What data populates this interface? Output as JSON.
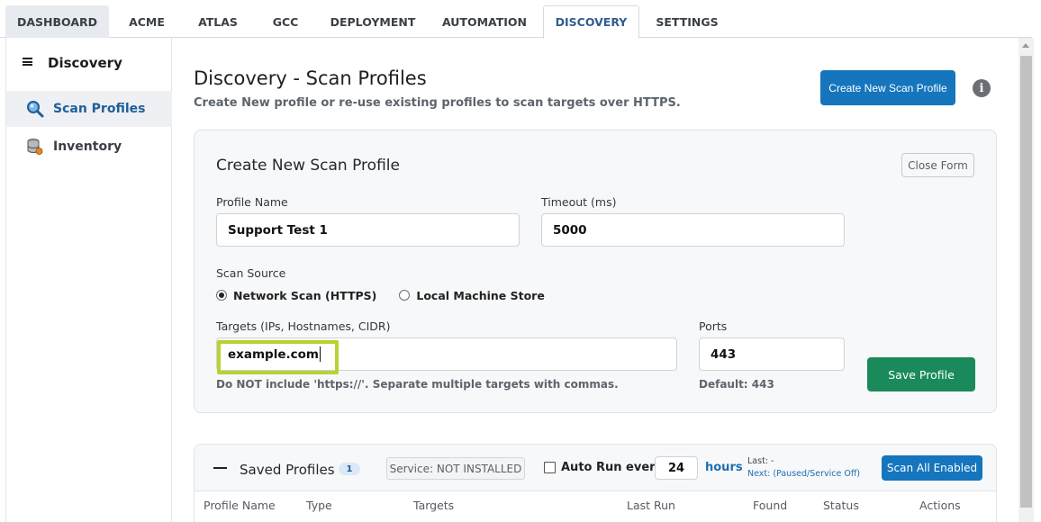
{
  "tabs": [
    {
      "label": "DASHBOARD",
      "active": false
    },
    {
      "label": "ACME",
      "active": false
    },
    {
      "label": "ATLAS",
      "active": false
    },
    {
      "label": "GCC",
      "active": false
    },
    {
      "label": "DEPLOYMENT",
      "active": false
    },
    {
      "label": "AUTOMATION",
      "active": false
    },
    {
      "label": "DISCOVERY",
      "active": true
    },
    {
      "label": "SETTINGS",
      "active": false
    }
  ],
  "sidebar": {
    "title": "Discovery",
    "items": [
      {
        "label": "Scan Profiles",
        "icon": "magnifier-icon",
        "active": true
      },
      {
        "label": "Inventory",
        "icon": "database-icon",
        "active": false
      }
    ]
  },
  "header": {
    "title": "Discovery - Scan Profiles",
    "subtitle": "Create New profile or re-use existing profiles to scan targets over HTTPS.",
    "create_button": "Create New Scan Profile",
    "info_icon": "i"
  },
  "form": {
    "title": "Create New Scan Profile",
    "close_button": "Close Form",
    "profile_name_label": "Profile Name",
    "profile_name_value": "Support Test 1",
    "timeout_label": "Timeout (ms)",
    "timeout_value": "5000",
    "scan_source_label": "Scan Source",
    "scan_source_options": [
      "Network Scan (HTTPS)",
      "Local Machine Store"
    ],
    "scan_source_selected": "Network Scan (HTTPS)",
    "targets_label": "Targets (IPs, Hostnames, CIDR)",
    "targets_value": "example.com",
    "targets_hint": "Do NOT include 'https://'. Separate multiple targets with commas.",
    "ports_label": "Ports",
    "ports_value": "443",
    "ports_hint": "Default: 443",
    "save_button": "Save Profile"
  },
  "saved": {
    "title": "Saved Profiles",
    "count": "1",
    "service_label": "Service:",
    "service_status": "NOT INSTALLED",
    "auto_run_label": "Auto Run every",
    "auto_run_checked": false,
    "hours_value": "24",
    "hours_label": "hours",
    "last_run": "Last: -",
    "next_run": "Next: (Paused/Service Off)",
    "scan_all_button": "Scan All Enabled",
    "columns": [
      "Profile Name",
      "Type",
      "Targets",
      "Last Run",
      "Found",
      "Status",
      "Actions"
    ]
  },
  "colors": {
    "primary": "#1575bd",
    "success": "#1b8a5a",
    "highlight": "#b8d230"
  }
}
